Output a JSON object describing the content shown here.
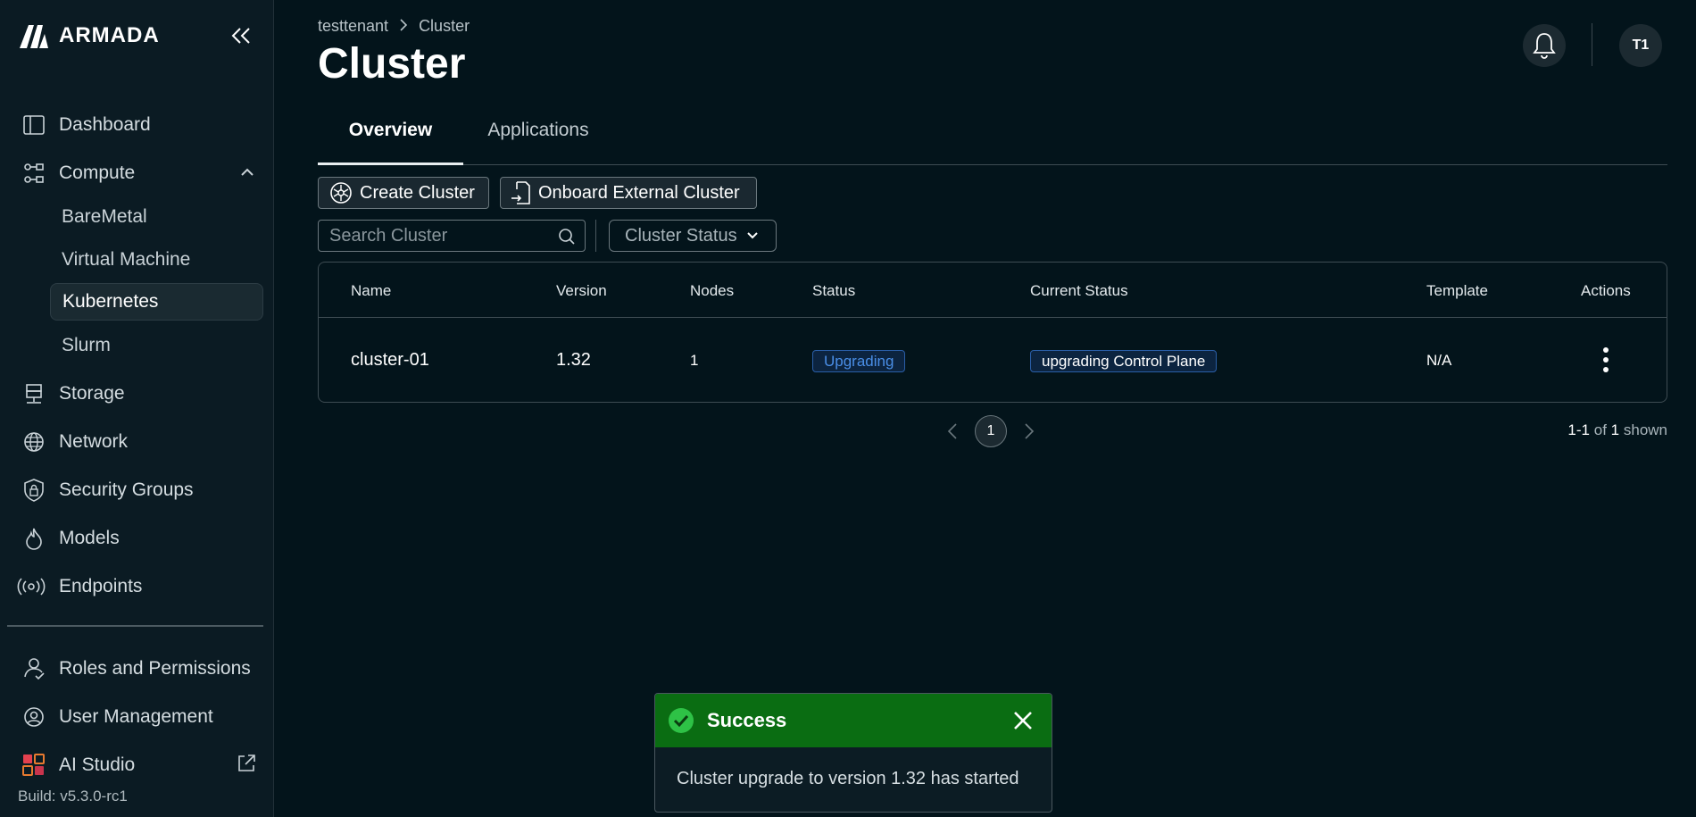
{
  "app": {
    "logo_text": "ARMADA",
    "build": "Build: v5.3.0-rc1"
  },
  "sidebar": {
    "items": [
      {
        "label": "Dashboard",
        "icon": "dashboard-icon"
      },
      {
        "label": "Compute",
        "icon": "compute-icon"
      },
      {
        "label": "Storage",
        "icon": "storage-icon"
      },
      {
        "label": "Network",
        "icon": "globe-icon"
      },
      {
        "label": "Security Groups",
        "icon": "shield-icon"
      },
      {
        "label": "Models",
        "icon": "flame-icon"
      },
      {
        "label": "Endpoints",
        "icon": "broadcast-icon"
      },
      {
        "label": "Roles and Permissions",
        "icon": "users-icon"
      },
      {
        "label": "User Management",
        "icon": "user-gear-icon"
      },
      {
        "label": "AI Studio",
        "icon": "grid-icon"
      }
    ],
    "compute_sub": [
      "BareMetal",
      "Virtual Machine",
      "Kubernetes",
      "Slurm"
    ],
    "active_sub": "Kubernetes"
  },
  "header": {
    "breadcrumb": [
      "testtenant",
      "Cluster"
    ],
    "title": "Cluster",
    "avatar": "T1"
  },
  "tabs": [
    "Overview",
    "Applications"
  ],
  "toolbar": {
    "create_label": "Create Cluster",
    "onboard_label": "Onboard External Cluster",
    "search_placeholder": "Search Cluster",
    "status_filter": "Cluster Status"
  },
  "table": {
    "columns": [
      "Name",
      "Version",
      "Nodes",
      "Status",
      "Current Status",
      "Template",
      "Actions"
    ],
    "rows": [
      {
        "name": "cluster-01",
        "version": "1.32",
        "nodes": "1",
        "status": "Upgrading",
        "current_status": "upgrading Control Plane",
        "template": "N/A"
      }
    ]
  },
  "pagination": {
    "current": "1",
    "range": "1-1",
    "of": "of",
    "total": "1",
    "suffix": "shown"
  },
  "toast": {
    "title": "Success",
    "message": "Cluster upgrade to version 1.32 has started"
  },
  "colors": {
    "background": "#03141b",
    "sidebar": "#0b1b23",
    "success": "#0a6d12",
    "badge_blue": "#4a8ee6"
  }
}
